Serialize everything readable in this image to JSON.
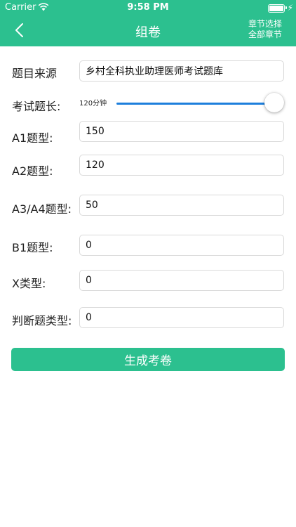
{
  "status_bar": {
    "carrier": "Carrier",
    "time": "9:58 PM"
  },
  "nav": {
    "title": "组卷",
    "right_line1": "章节选择",
    "right_line2": "全部章节"
  },
  "form": {
    "source_label": "题目来源",
    "source_value": "乡村全科执业助理医师考试题库",
    "duration_label": "考试题长:",
    "duration_value_text": "120分钟",
    "duration_slider_level": 1.0,
    "a1_label": "A1题型:",
    "a1_value": "150",
    "a2_label": "A2题型:",
    "a2_value": "120",
    "a3a4_label": "A3/A4题型:",
    "a3a4_value": "50",
    "b1_label": "B1题型:",
    "b1_value": "0",
    "x_label": "X类型:",
    "x_value": "0",
    "judge_label": "判断题类型:",
    "judge_value": "0"
  },
  "generate_button": "生成考卷",
  "colors": {
    "accent": "#2cc08f",
    "slider": "#1d7fdc"
  }
}
